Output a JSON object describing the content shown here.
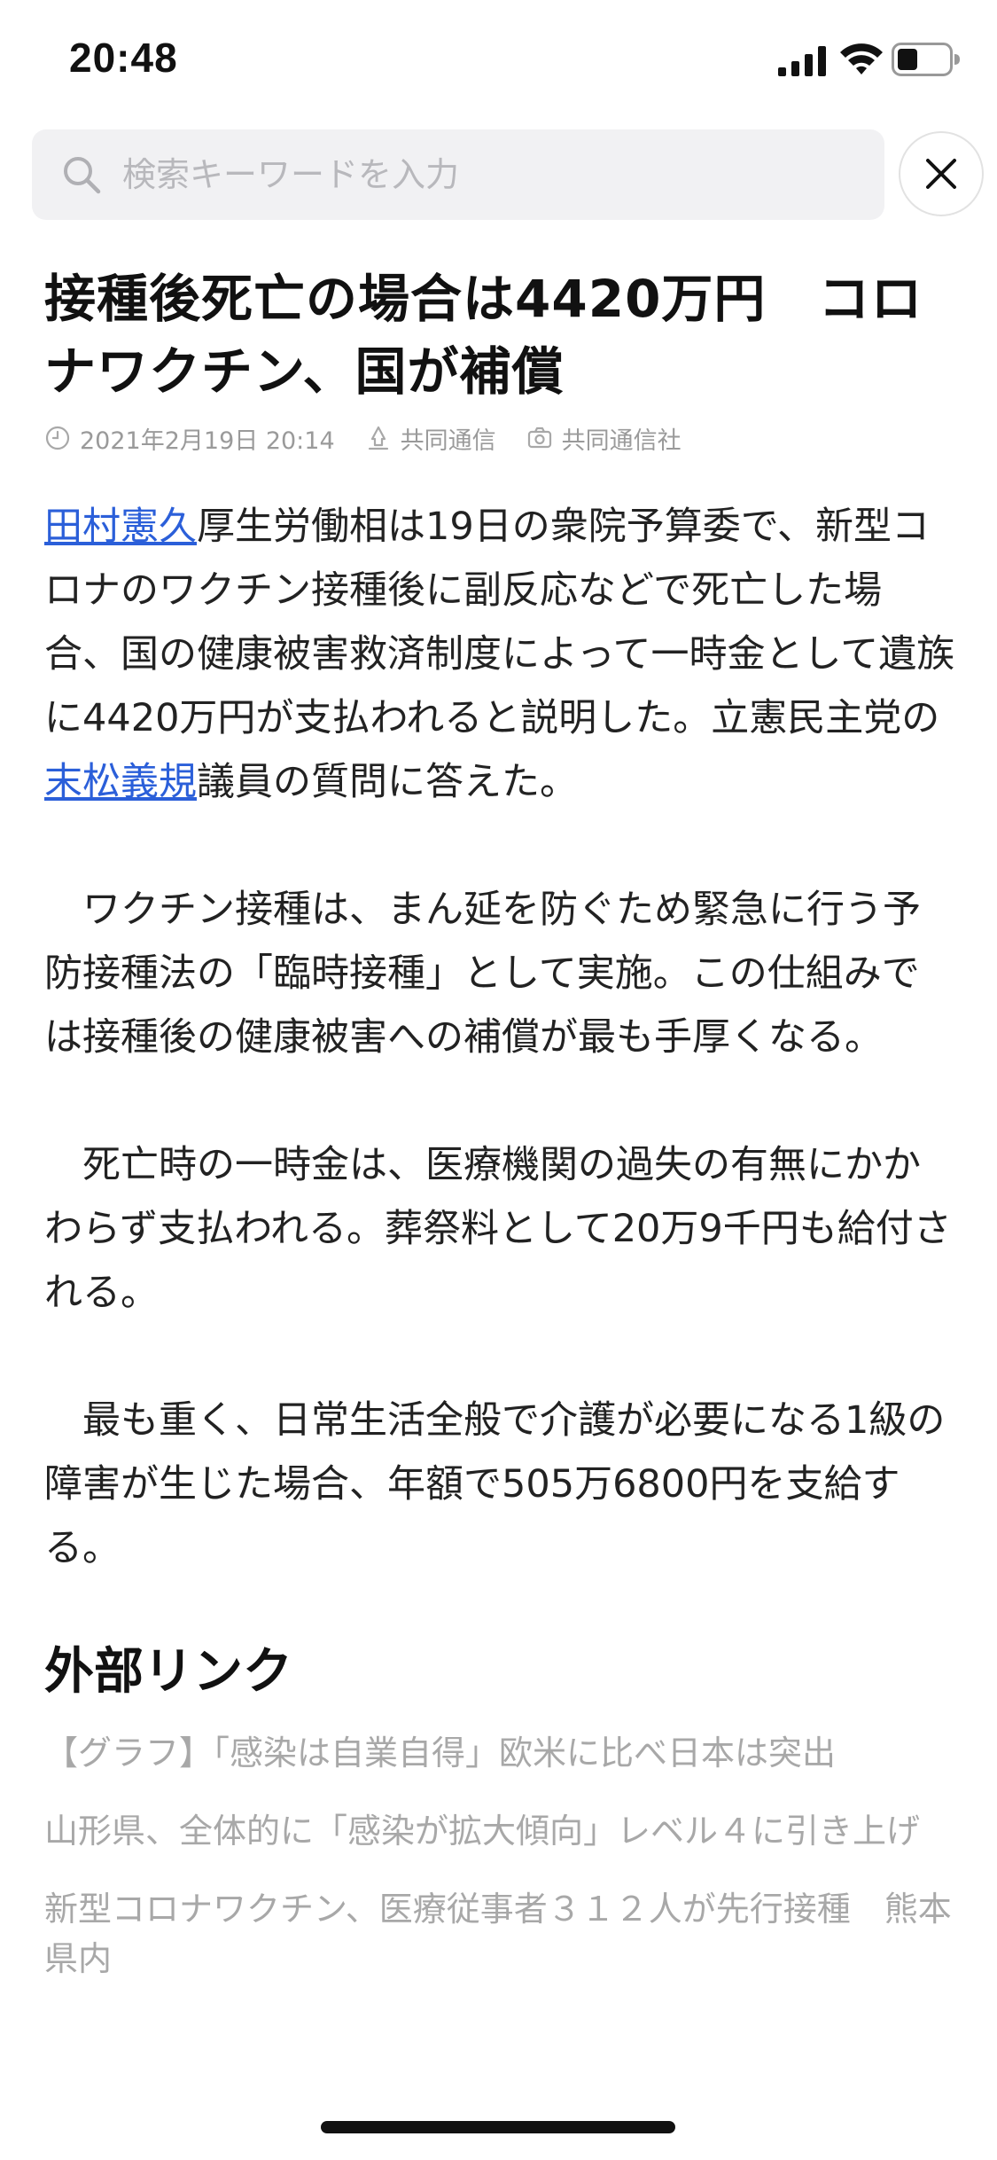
{
  "status_bar": {
    "time": "20:48"
  },
  "search": {
    "placeholder": "検索キーワードを入力"
  },
  "article": {
    "headline": "接種後死亡の場合は4420万円　コロナワクチン、国が補償",
    "date": "2021年2月19日 20:14",
    "source": "共同通信",
    "photo_credit": "共同通信社",
    "paragraph1": {
      "link1": "田村憲久",
      "text1": "厚生労働相は19日の衆院予算委で、新型コロナのワクチン接種後に副反応などで死亡した場合、国の健康被害救済制度によって一時金として遺族に4420万円が支払われると説明した。立憲民主党の",
      "link2": "末松義規",
      "text2": "議員の質問に答えた。"
    },
    "paragraph2": "　ワクチン接種は、まん延を防ぐため緊急に行う予防接種法の「臨時接種」として実施。この仕組みでは接種後の健康被害への補償が最も手厚くなる。",
    "paragraph3": "　死亡時の一時金は、医療機関の過失の有無にかかわらず支払われる。葬祭料として20万9千円も給付される。",
    "paragraph4": "　最も重く、日常生活全般で介護が必要になる1級の障害が生じた場合、年額で505万6800円を支給する。"
  },
  "external_links": {
    "title": "外部リンク",
    "items": [
      "【グラフ】「感染は自業自得」欧米に比べ日本は突出",
      "山形県、全体的に「感染が拡大傾向」レベル４に引き上げ",
      "新型コロナワクチン、医療従事者３１２人が先行接種　熊本県内"
    ]
  },
  "colors": {
    "link": "#2b5fd9",
    "meta": "#9a9a9a",
    "external_link": "#a8a8a8"
  }
}
